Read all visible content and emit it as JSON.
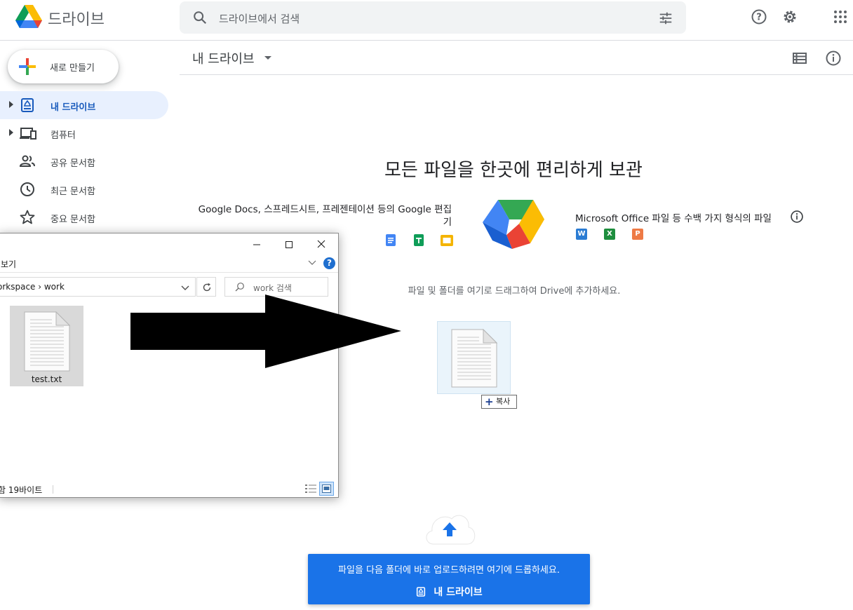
{
  "app": {
    "name": "드라이브"
  },
  "search": {
    "placeholder": "드라이브에서 검색"
  },
  "sidebar": {
    "new_label": "새로 만들기",
    "items": [
      {
        "label": "내 드라이브"
      },
      {
        "label": "컴퓨터"
      },
      {
        "label": "공유 문서함"
      },
      {
        "label": "최근 문서함"
      },
      {
        "label": "중요 문서함"
      }
    ]
  },
  "main": {
    "title": "내 드라이브",
    "headline": "모든 파일을 한곳에 편리하게 보관",
    "google_text_1": "Google Docs, 스프레드시트, 프레젠테이션 등의 Google 편집",
    "google_text_2": "기",
    "ms_text": "Microsoft Office 파일 등 수백 가지 형식의 파일",
    "ms_badges": [
      "W",
      "X",
      "P"
    ],
    "drag_hint": "파일 및 폴더를 여기로 드래그하여 Drive에 추가하세요.",
    "copy_tip": "복사"
  },
  "explorer": {
    "menu_view": "보기",
    "breadcrumb": "orkspace  ›  work",
    "search_placeholder": "work 검색",
    "file_name": "test.txt",
    "status": "함 19바이트"
  },
  "upload": {
    "message": "파일을 다음 폴더에 바로 업로드하려면 여기에 드롭하세요.",
    "destination": "내 드라이브"
  },
  "colors": {
    "accent": "#1a73e8",
    "active_nav_bg": "#e8f0fe",
    "active_nav_text": "#185abc"
  }
}
